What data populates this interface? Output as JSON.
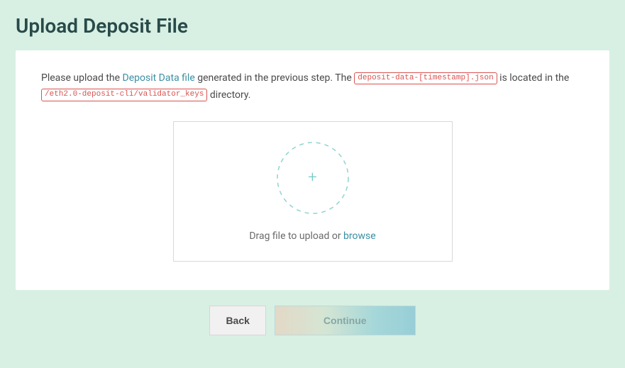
{
  "page": {
    "title": "Upload Deposit File"
  },
  "instruction": {
    "part1": "Please upload the ",
    "link1": "Deposit Data file",
    "part2": " generated in the previous step. The ",
    "code1": "deposit-data-[timestamp].json",
    "part3": " is located in the ",
    "code2": "/eth2.0-deposit-cli/validator_keys",
    "part4": " directory."
  },
  "dropzone": {
    "text_prefix": "Drag file to upload or ",
    "browse": "browse"
  },
  "buttons": {
    "back": "Back",
    "continue": "Continue"
  }
}
